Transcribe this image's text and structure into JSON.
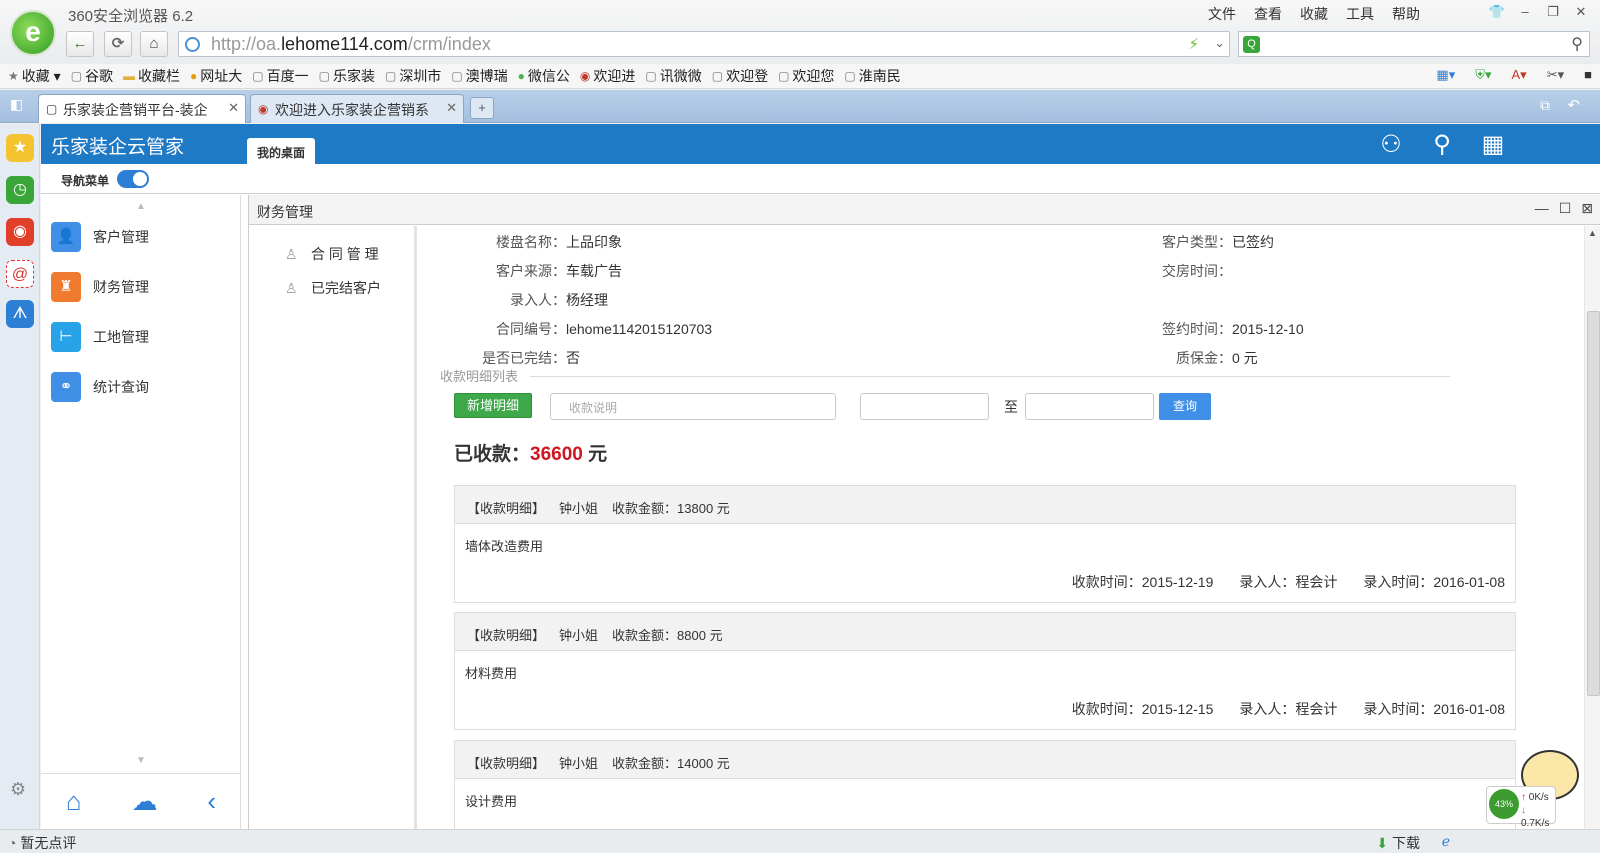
{
  "browser": {
    "title": "360安全浏览器 6.2",
    "menu": [
      "文件",
      "查看",
      "收藏",
      "工具",
      "帮助"
    ],
    "url_prefix": "http://oa.",
    "url_domain": "lehome114.com",
    "url_path": "/crm/index",
    "bookmarks": [
      "收藏",
      "谷歌",
      "收藏栏",
      "网址大",
      "百度一",
      "乐家装",
      "深圳市",
      "澳博瑞",
      "微信公",
      "欢迎进",
      "讯微微",
      "欢迎登",
      "欢迎您",
      "淮南民"
    ],
    "tabs": [
      "乐家装企营销平台-装企",
      "欢迎进入乐家装企营销系"
    ],
    "status_left": "暂无点评",
    "status_download": "下载",
    "net_percent": "43%",
    "net_up": "0K/s",
    "net_down": "0.7K/s"
  },
  "app": {
    "brand": "乐家装企云管家",
    "desk_tab": "我的桌面",
    "nav_label": "导航菜单",
    "nav_items": [
      "客户管理",
      "财务管理",
      "工地管理",
      "统计查询"
    ]
  },
  "panel": {
    "title": "财务管理",
    "subnav": [
      "合 同 管 理",
      "已完结客户"
    ]
  },
  "contract": {
    "building_label": "楼盘名称：",
    "building": "上品印象",
    "customer_type_label": "客户类型：",
    "customer_type": "已签约",
    "source_label": "客户来源：",
    "source": "车载广告",
    "handover_label": "交房时间：",
    "handover": "",
    "entered_by_label": "录入人：",
    "entered_by": "杨经理",
    "contract_no_label": "合同编号：",
    "contract_no": "lehome1142015120703",
    "sign_date_label": "签约时间：",
    "sign_date": "2015-12-10",
    "completed_label": "是否已完结：",
    "completed": "否",
    "deposit_label": "质保金：",
    "deposit": "0 元"
  },
  "receipts": {
    "section_title": "收款明细列表",
    "add_button": "新增明细",
    "desc_placeholder": "收款说明",
    "to_label": "至",
    "query_button": "查询",
    "total_label": "已收款：",
    "total_amount": "36600",
    "total_unit": "元",
    "items": [
      {
        "tag": "【收款明细】",
        "person": "钟小姐",
        "amount": "收款金额：13800 元",
        "desc": "墙体改造费用",
        "time": "收款时间：2015-12-19",
        "by": "录入人：程会计",
        "entry_time": "录入时间：2016-01-08"
      },
      {
        "tag": "【收款明细】",
        "person": "钟小姐",
        "amount": "收款金额：8800 元",
        "desc": "材料费用",
        "time": "收款时间：2015-12-15",
        "by": "录入人：程会计",
        "entry_time": "录入时间：2016-01-08"
      },
      {
        "tag": "【收款明细】",
        "person": "钟小姐",
        "amount": "收款金额：14000 元",
        "desc": "设计费用",
        "time": "",
        "by": "",
        "entry_time": ""
      }
    ]
  }
}
